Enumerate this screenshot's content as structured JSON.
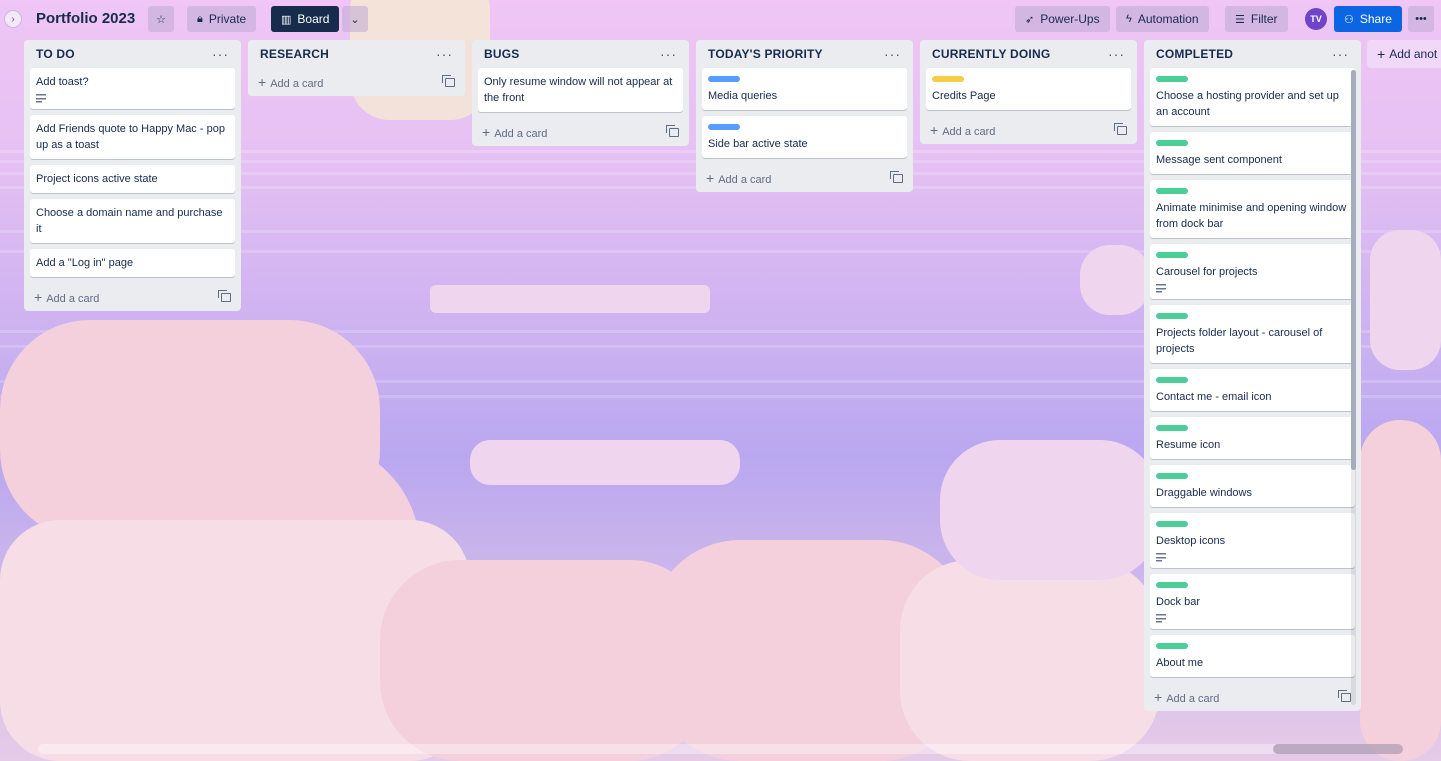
{
  "board": {
    "title": "Portfolio 2023",
    "visibility_label": "Private",
    "view_label": "Board"
  },
  "toolbar": {
    "powerups_label": "Power-Ups",
    "automation_label": "Automation",
    "filter_label": "Filter",
    "avatar_initials": "TV",
    "share_label": "Share"
  },
  "add_list_label": "Add anot",
  "add_card_label": "Add a card",
  "colors": {
    "label_blue": "#579dff",
    "label_yellow": "#f5cd47",
    "label_green": "#4bce97"
  },
  "lists": [
    {
      "title": "TO DO",
      "cards": [
        {
          "text": "Add toast?",
          "has_description": true
        },
        {
          "text": "Add Friends quote to Happy Mac - pop up as a toast"
        },
        {
          "text": "Project icons active state"
        },
        {
          "text": "Choose a domain name and purchase it"
        },
        {
          "text": "Add a \"Log in\" page"
        }
      ]
    },
    {
      "title": "RESEARCH",
      "cards": []
    },
    {
      "title": "BUGS",
      "cards": [
        {
          "text": "Only resume window will not appear at the front"
        }
      ]
    },
    {
      "title": "TODAY'S PRIORITY",
      "cards": [
        {
          "text": "Media queries",
          "label": "blue"
        },
        {
          "text": "Side bar active state",
          "label": "blue"
        }
      ]
    },
    {
      "title": "CURRENTLY DOING",
      "cards": [
        {
          "text": "Credits Page",
          "label": "yellow"
        }
      ]
    },
    {
      "title": "COMPLETED",
      "cards": [
        {
          "text": "Choose a hosting provider and set up an account",
          "label": "green"
        },
        {
          "text": "Message sent component",
          "label": "green"
        },
        {
          "text": "Animate minimise and opening window from dock bar",
          "label": "green"
        },
        {
          "text": "Carousel for projects",
          "label": "green",
          "has_description": true
        },
        {
          "text": "Projects folder layout - carousel of projects",
          "label": "green"
        },
        {
          "text": "Contact me - email icon",
          "label": "green"
        },
        {
          "text": "Resume icon",
          "label": "green"
        },
        {
          "text": "Draggable windows",
          "label": "green"
        },
        {
          "text": "Desktop icons",
          "label": "green",
          "has_description": true
        },
        {
          "text": "Dock bar",
          "label": "green",
          "has_description": true
        },
        {
          "text": "About me",
          "label": "green"
        }
      ]
    }
  ]
}
